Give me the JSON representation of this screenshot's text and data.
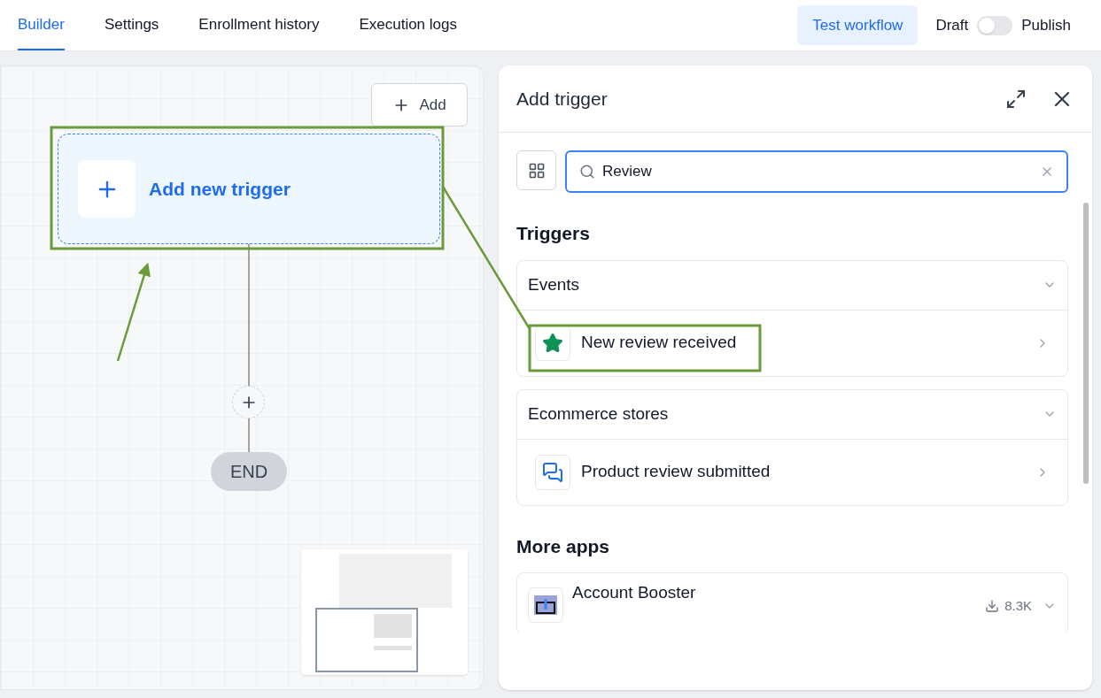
{
  "tabs": [
    {
      "label": "Builder",
      "selected": true
    },
    {
      "label": "Settings",
      "selected": false
    },
    {
      "label": "Enrollment history",
      "selected": false
    },
    {
      "label": "Execution logs",
      "selected": false
    }
  ],
  "header": {
    "test_button": "Test workflow",
    "draft_label": "Draft",
    "publish_on": false,
    "publish_label": "Publish"
  },
  "canvas": {
    "add_button": "Add",
    "trigger_node": "Add new trigger",
    "end_node": "END"
  },
  "panel": {
    "title": "Add trigger",
    "search": {
      "value": "Review"
    },
    "sections": [
      {
        "title": "Triggers",
        "groups": [
          {
            "title": "Events",
            "expanded": true,
            "items": [
              {
                "label": "New review received",
                "kind": "star"
              }
            ]
          },
          {
            "title": "Ecommerce stores",
            "expanded": true,
            "items": [
              {
                "label": "Product review submitted",
                "kind": "chat"
              }
            ]
          }
        ]
      }
    ],
    "more_apps": {
      "title": "More apps",
      "apps": [
        {
          "name": "Account Booster",
          "downloads": "8.3K"
        }
      ]
    }
  }
}
